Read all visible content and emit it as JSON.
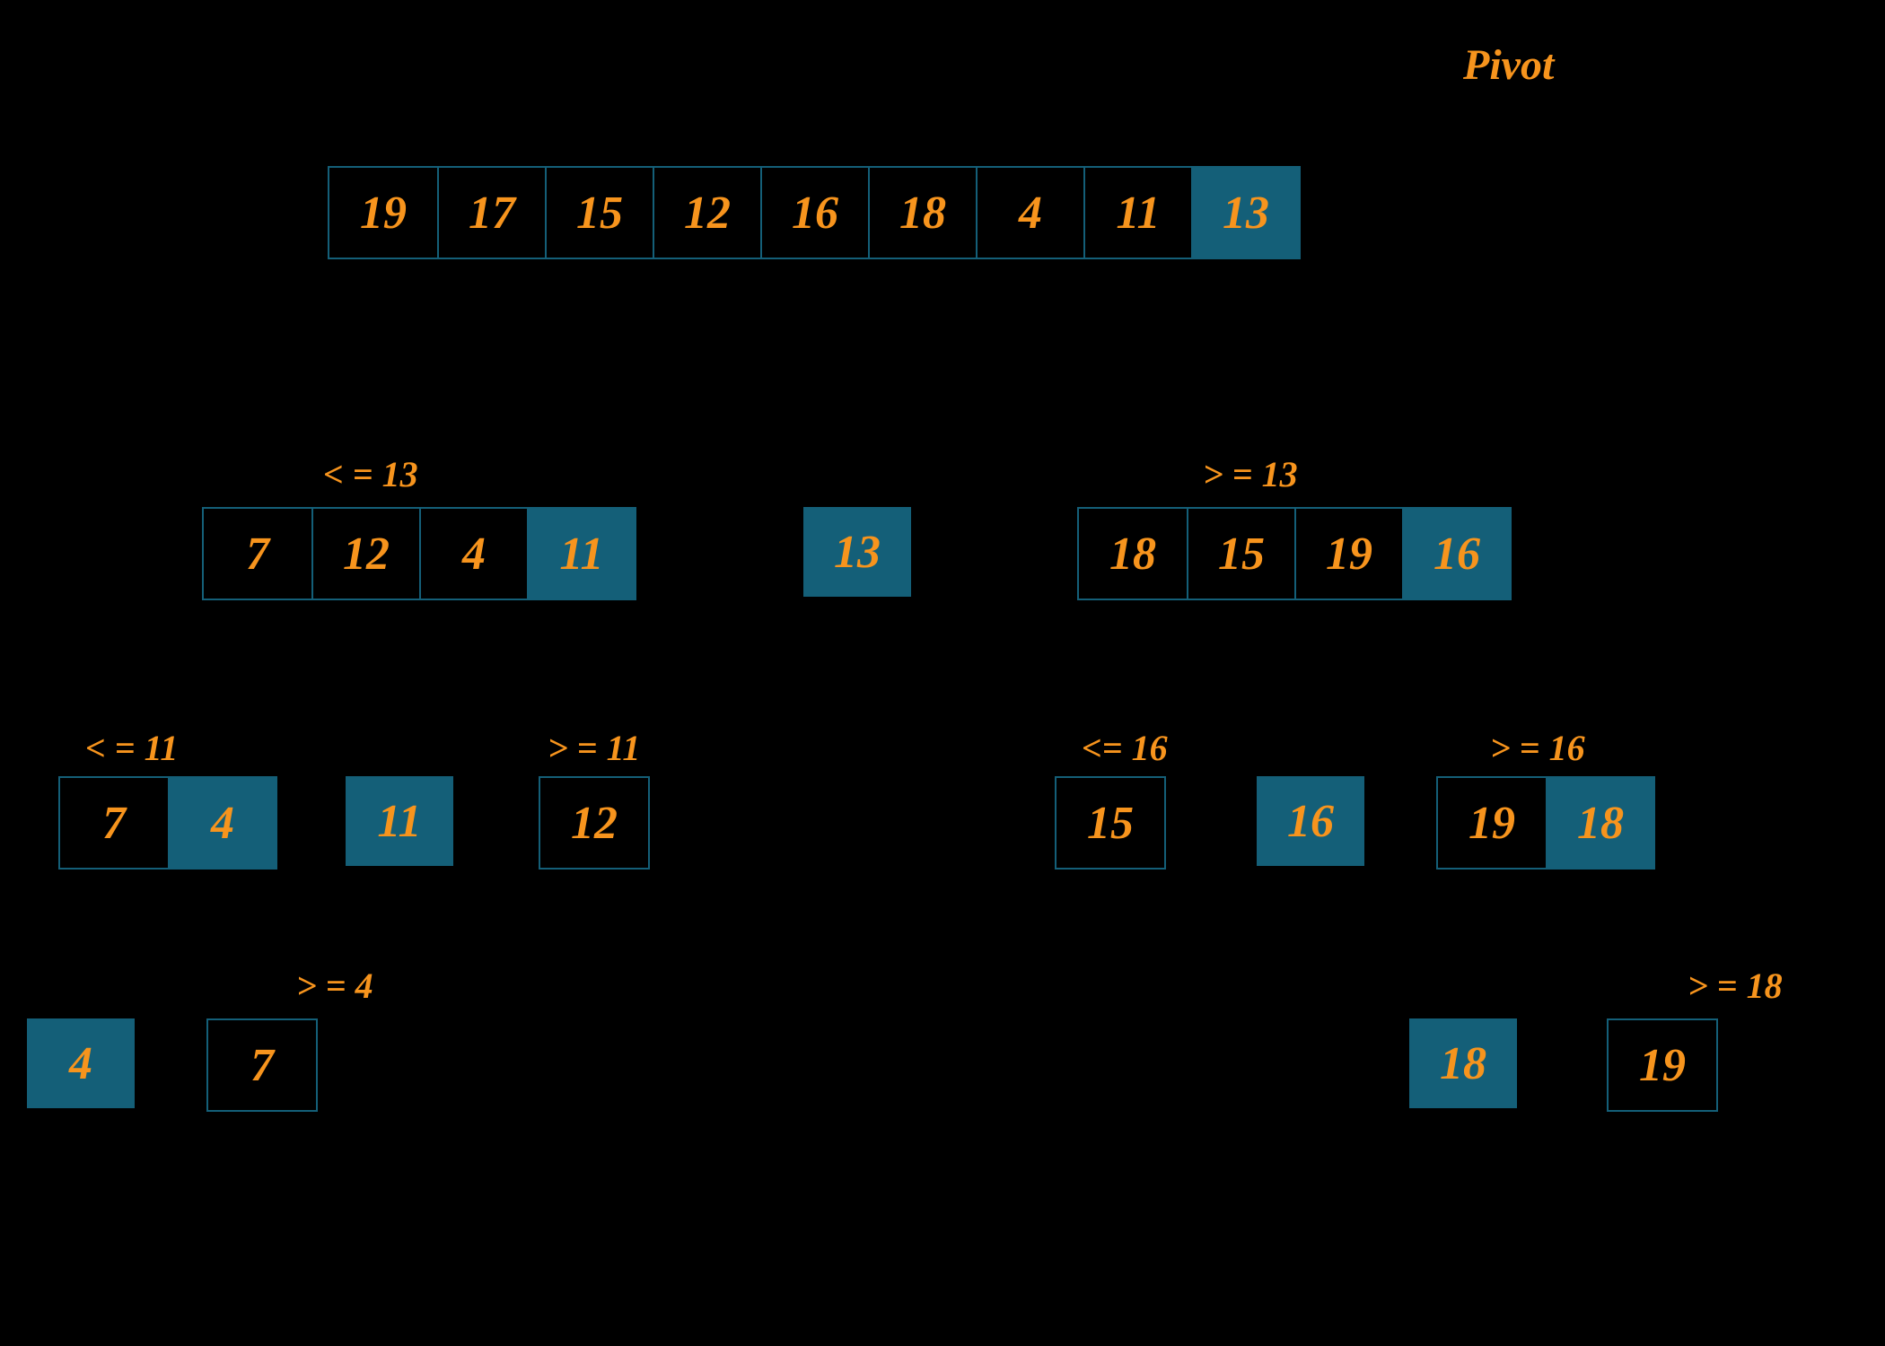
{
  "title": "Pivot",
  "level0": {
    "cells": [
      "19",
      "17",
      "15",
      "12",
      "16",
      "18",
      "4",
      "11",
      "13"
    ]
  },
  "level1": {
    "left_label": "< = 13",
    "left_cells": [
      "7",
      "12",
      "4",
      "11"
    ],
    "mid": "13",
    "right_label": "> = 13",
    "right_cells": [
      "18",
      "15",
      "19",
      "16"
    ]
  },
  "level2": {
    "ll_label": "< = 11",
    "ll_cells": [
      "7",
      "4"
    ],
    "lmid": "11",
    "lr_label": "> = 11",
    "lr_cells": [
      "12"
    ],
    "rl_label": "<= 16",
    "rl_cells": [
      "15"
    ],
    "rmid": "16",
    "rr_label": "> = 16",
    "rr_cells": [
      "19",
      "18"
    ]
  },
  "level3": {
    "l_mid": "4",
    "l_label": "> = 4",
    "l_cells": [
      "7"
    ],
    "r_mid": "18",
    "r_label": "> = 18",
    "r_cells": [
      "19"
    ]
  }
}
